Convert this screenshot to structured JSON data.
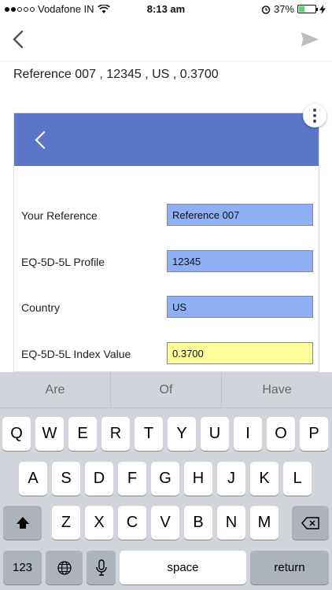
{
  "status_bar": {
    "carrier": "Vodafone IN",
    "time": "8:13 am",
    "battery": "37%",
    "battery_level": 0.37
  },
  "nav": {
    "back": "back",
    "send": "send"
  },
  "subject": "Reference 007 , 12345 , US , 0.3700",
  "form": {
    "rows": [
      {
        "label": "Your Reference",
        "value": "Reference 007"
      },
      {
        "label": "EQ-5D-5L Profile",
        "value": "12345"
      },
      {
        "label": "Country",
        "value": "US"
      },
      {
        "label": "EQ-5D-5L Index Value",
        "value": "0.3700"
      }
    ]
  },
  "keyboard": {
    "suggestions": [
      "Are",
      "Of",
      "Have"
    ],
    "row1": [
      "Q",
      "W",
      "E",
      "R",
      "T",
      "Y",
      "U",
      "I",
      "O",
      "P"
    ],
    "row2": [
      "A",
      "S",
      "D",
      "F",
      "G",
      "H",
      "J",
      "K",
      "L"
    ],
    "row3": [
      "Z",
      "X",
      "C",
      "V",
      "B",
      "N",
      "M"
    ],
    "numbers_key": "123",
    "space_key": "space",
    "return_key": "return"
  },
  "colors": {
    "header": "#5b76c9",
    "field_blue": "#8fb0f5",
    "field_yellow": "#ffff99"
  }
}
